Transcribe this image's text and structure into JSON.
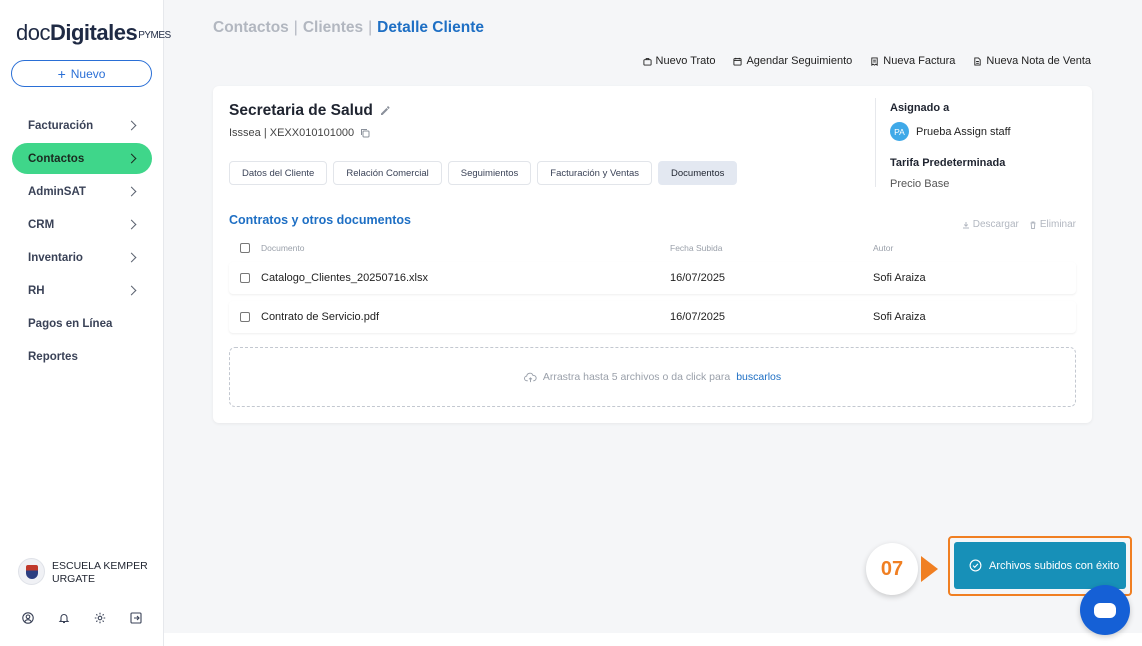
{
  "brand": {
    "thin": "doc",
    "bold": "Digitales",
    "suffix": "PYMES"
  },
  "sidebar": {
    "new_button": "Nuevo",
    "items": [
      {
        "label": "Facturación",
        "has_children": true
      },
      {
        "label": "Contactos",
        "has_children": true,
        "active": true
      },
      {
        "label": "AdminSAT",
        "has_children": true
      },
      {
        "label": "CRM",
        "has_children": true
      },
      {
        "label": "Inventario",
        "has_children": true
      },
      {
        "label": "RH",
        "has_children": true
      },
      {
        "label": "Pagos en Línea",
        "has_children": false
      },
      {
        "label": "Reportes",
        "has_children": false
      }
    ],
    "organization": "ESCUELA KEMPER URGATE",
    "bottom_icons": [
      "user-circle-icon",
      "bell-icon",
      "gear-icon",
      "logout-icon"
    ]
  },
  "breadcrumb": {
    "items": [
      "Contactos",
      "Clientes"
    ],
    "current": "Detalle Cliente",
    "separator": "|"
  },
  "actions": [
    "Nuevo Trato",
    "Agendar Seguimiento",
    "Nueva Factura",
    "Nueva Nota de Venta"
  ],
  "client": {
    "name": "Secretaria de Salud",
    "subtitle": "Isssea | XEXX010101000",
    "tabs": [
      "Datos del Cliente",
      "Relación Comercial",
      "Seguimientos",
      "Facturación y Ventas",
      "Documentos"
    ],
    "active_tab": "Documentos",
    "assigned_label": "Asignado a",
    "assignee_initials": "PA",
    "assignee_name": "Prueba Assign staff",
    "tarifa_label": "Tarifa Predeterminada",
    "tarifa_value": "Precio Base"
  },
  "documents": {
    "title": "Contratos y otros documentos",
    "download_label": "Descargar",
    "delete_label": "Eliminar",
    "columns": [
      "Documento",
      "Fecha Subida",
      "Autor"
    ],
    "rows": [
      {
        "name": "Catalogo_Clientes_20250716.xlsx",
        "date": "16/07/2025",
        "author": "Sofi Araiza"
      },
      {
        "name": "Contrato de Servicio.pdf",
        "date": "16/07/2025",
        "author": "Sofi Araiza"
      }
    ],
    "dropzone_text": "Arrastra hasta 5 archivos o da click para",
    "dropzone_link": "buscarlos"
  },
  "toast": {
    "message": "Archivos subidos con éxito",
    "step": "07"
  },
  "colors": {
    "accent": "#1e6fc4",
    "active_nav": "#3fd68a",
    "toast": "#1790b8",
    "highlight": "#f07f22",
    "chat": "#1560d6"
  }
}
